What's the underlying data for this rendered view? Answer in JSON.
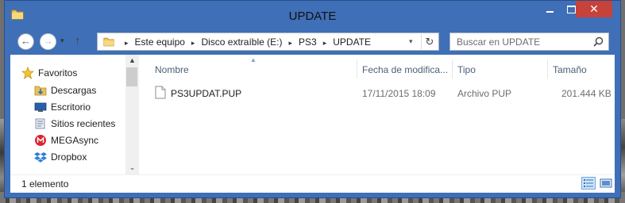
{
  "window": {
    "title": "UPDATE"
  },
  "title_buttons": {
    "minimize": "minimize-icon",
    "maximize": "maximize-icon",
    "close": "✕"
  },
  "nav": {
    "back_icon": "←",
    "forward_icon": "→",
    "recent_icon": "▾",
    "up_icon": "↑"
  },
  "address": {
    "breadcrumbs": [
      "Este equipo",
      "Disco extraíble (E:)",
      "PS3",
      "UPDATE"
    ],
    "separator": "▸",
    "dropdown_icon": "▾",
    "refresh_icon": "↻"
  },
  "search": {
    "placeholder": "Buscar en UPDATE"
  },
  "sidebar": {
    "items": [
      {
        "label": "Favoritos",
        "icon": "star-icon"
      },
      {
        "label": "Descargas",
        "icon": "downloads-folder-icon"
      },
      {
        "label": "Escritorio",
        "icon": "desktop-icon"
      },
      {
        "label": "Sitios recientes",
        "icon": "recent-places-icon"
      },
      {
        "label": "MEGAsync",
        "icon": "megasync-icon"
      },
      {
        "label": "Dropbox",
        "icon": "dropbox-icon"
      }
    ],
    "scroll_up": "▲",
    "scroll_down": "⌄"
  },
  "columns": {
    "sort_indicator": "▲",
    "headers": [
      "Nombre",
      "Fecha de modifica...",
      "Tipo",
      "Tamaño"
    ]
  },
  "files": [
    {
      "name": "PS3UPDAT.PUP",
      "date": "17/11/2015 18:09",
      "type": "Archivo PUP",
      "size": "201.444 KB",
      "icon": "file-icon"
    }
  ],
  "status": {
    "text": "1 elemento"
  },
  "colors": {
    "titlebar": "#3f6fb7",
    "close_button": "#c7423a",
    "header_text": "#4c607a"
  }
}
